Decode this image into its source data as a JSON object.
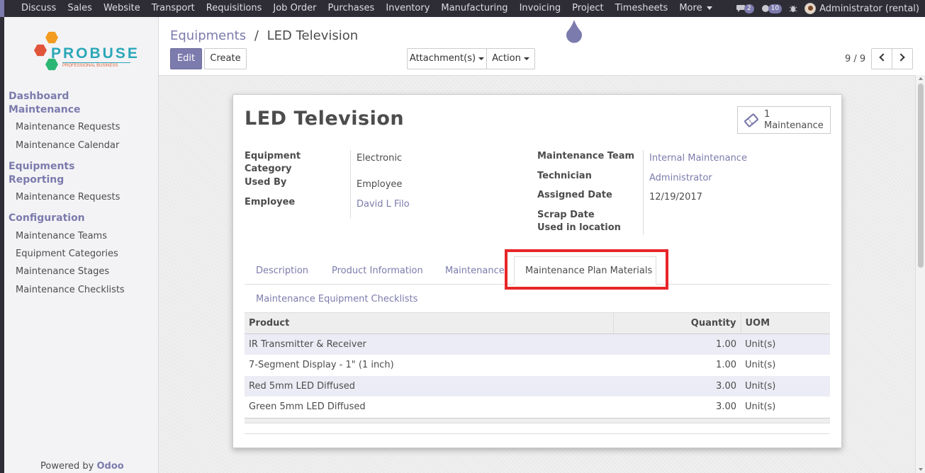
{
  "topnav": {
    "items": [
      "Discuss",
      "Sales",
      "Website",
      "Transport",
      "Requisitions",
      "Job Order",
      "Purchases",
      "Inventory",
      "Manufacturing",
      "Invoicing",
      "Project",
      "Timesheets",
      "More"
    ],
    "chat_count": "2",
    "activity_count": "10",
    "user": "Administrator (rental)"
  },
  "logo": {
    "name": "PROBUSE",
    "tagline": "PROFESSIONAL BUSINESS"
  },
  "sidebar": {
    "sections": [
      {
        "title": "Dashboard Maintenance",
        "line1": "Dashboard",
        "line2": "Maintenance",
        "items": [
          "Maintenance Requests",
          "Maintenance Calendar"
        ]
      },
      {
        "title": "Equipments Reporting",
        "line1": "Equipments",
        "line2": "Reporting",
        "items": [
          "Maintenance Requests"
        ]
      },
      {
        "title": "Configuration",
        "items": [
          "Maintenance Teams",
          "Equipment Categories",
          "Maintenance Stages",
          "Maintenance Checklists"
        ]
      }
    ],
    "powered_prefix": "Powered by",
    "powered_brand": "Odoo"
  },
  "breadcrumb": {
    "parent": "Equipments",
    "separator": "/",
    "current": "LED Television"
  },
  "toolbar": {
    "edit": "Edit",
    "create": "Create",
    "attachments": "Attachment(s)",
    "action": "Action"
  },
  "pager": {
    "text": "9 / 9"
  },
  "record": {
    "title": "LED Television",
    "smart_button": {
      "count": "1",
      "label": "Maintenance"
    },
    "left_fields": [
      {
        "label1": "Equipment",
        "label2": "Category",
        "value": "Electronic"
      },
      {
        "label": "Used By",
        "value": "Employee"
      },
      {
        "label": "Employee",
        "value": "David L Filo"
      }
    ],
    "right_fields": [
      {
        "label": "Maintenance Team",
        "value": "Internal Maintenance"
      },
      {
        "label": "Technician",
        "value": "Administrator"
      },
      {
        "label": "Assigned Date",
        "value": "12/19/2017"
      },
      {
        "label": "Scrap Date",
        "value": ""
      },
      {
        "label": "Used in location",
        "value": ""
      }
    ]
  },
  "tabs": [
    "Description",
    "Product Information",
    "Maintenance",
    "Maintenance Plan Materials",
    "Maintenance Equipment Checklists"
  ],
  "active_tab": "Maintenance Plan Materials",
  "table": {
    "headers": [
      "Product",
      "Quantity",
      "UOM"
    ],
    "rows": [
      {
        "product": "IR Transmitter & Receiver",
        "qty": "1.00",
        "uom": "Unit(s)"
      },
      {
        "product": "7-Segment Display - 1\" (1 inch)",
        "qty": "1.00",
        "uom": "Unit(s)"
      },
      {
        "product": "Red 5mm LED Diffused",
        "qty": "3.00",
        "uom": "Unit(s)"
      },
      {
        "product": "Green 5mm LED Diffused",
        "qty": "3.00",
        "uom": "Unit(s)"
      }
    ]
  },
  "colors": {
    "brand": "#7c7bad",
    "navbar": "#2e2d35",
    "highlight": "#e8262a"
  }
}
